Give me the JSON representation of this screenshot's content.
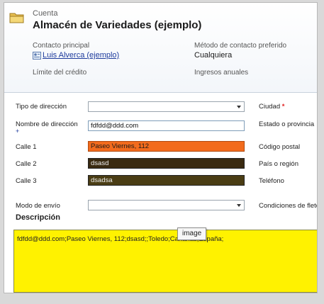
{
  "header": {
    "entity_type": "Cuenta",
    "record_title": "Almacén de Variedades (ejemplo)",
    "primary_contact_label": "Contacto principal",
    "primary_contact_value": "Luis Alverca (ejemplo)",
    "preferred_contact_label": "Método de contacto preferido",
    "preferred_contact_value": "Cualquiera",
    "credit_limit_label": "Límite del crédito",
    "annual_income_label": "Ingresos anuales"
  },
  "form": {
    "address_type_label": "Tipo de dirección",
    "address_type_value": "",
    "address_name_label": "Nombre de dirección",
    "address_name_value": "fdfdd@ddd.com",
    "street1_label": "Calle 1",
    "street1_value": "Paseo Viernes, 112",
    "street2_label": "Calle 2",
    "street2_value": "dsasd",
    "street3_label": "Calle 3",
    "street3_value": "dsadsa",
    "shipping_method_label": "Modo de envío",
    "shipping_method_value": "",
    "city_label": "Ciudad",
    "state_label": "Estado o provincia",
    "postal_code_label": "Código postal",
    "country_label": "País o región",
    "phone_label": "Teléfono",
    "terms_label": "Condiciones de flete",
    "required_marker": "*",
    "recommended_marker": "+"
  },
  "description": {
    "section_title": "Descripción",
    "value": "fdfdd@ddd.com;Paseo Viernes, 112;dsasd;;Toledo;Canarias;España;"
  },
  "tooltip": {
    "text": "image"
  },
  "colors": {
    "street1_bg": "#f26b1d",
    "street2_bg": "#3a2a10",
    "street3_bg": "#4a3d14",
    "description_bg": "#fff200",
    "link": "#1c3a9c",
    "required": "#e02020"
  }
}
